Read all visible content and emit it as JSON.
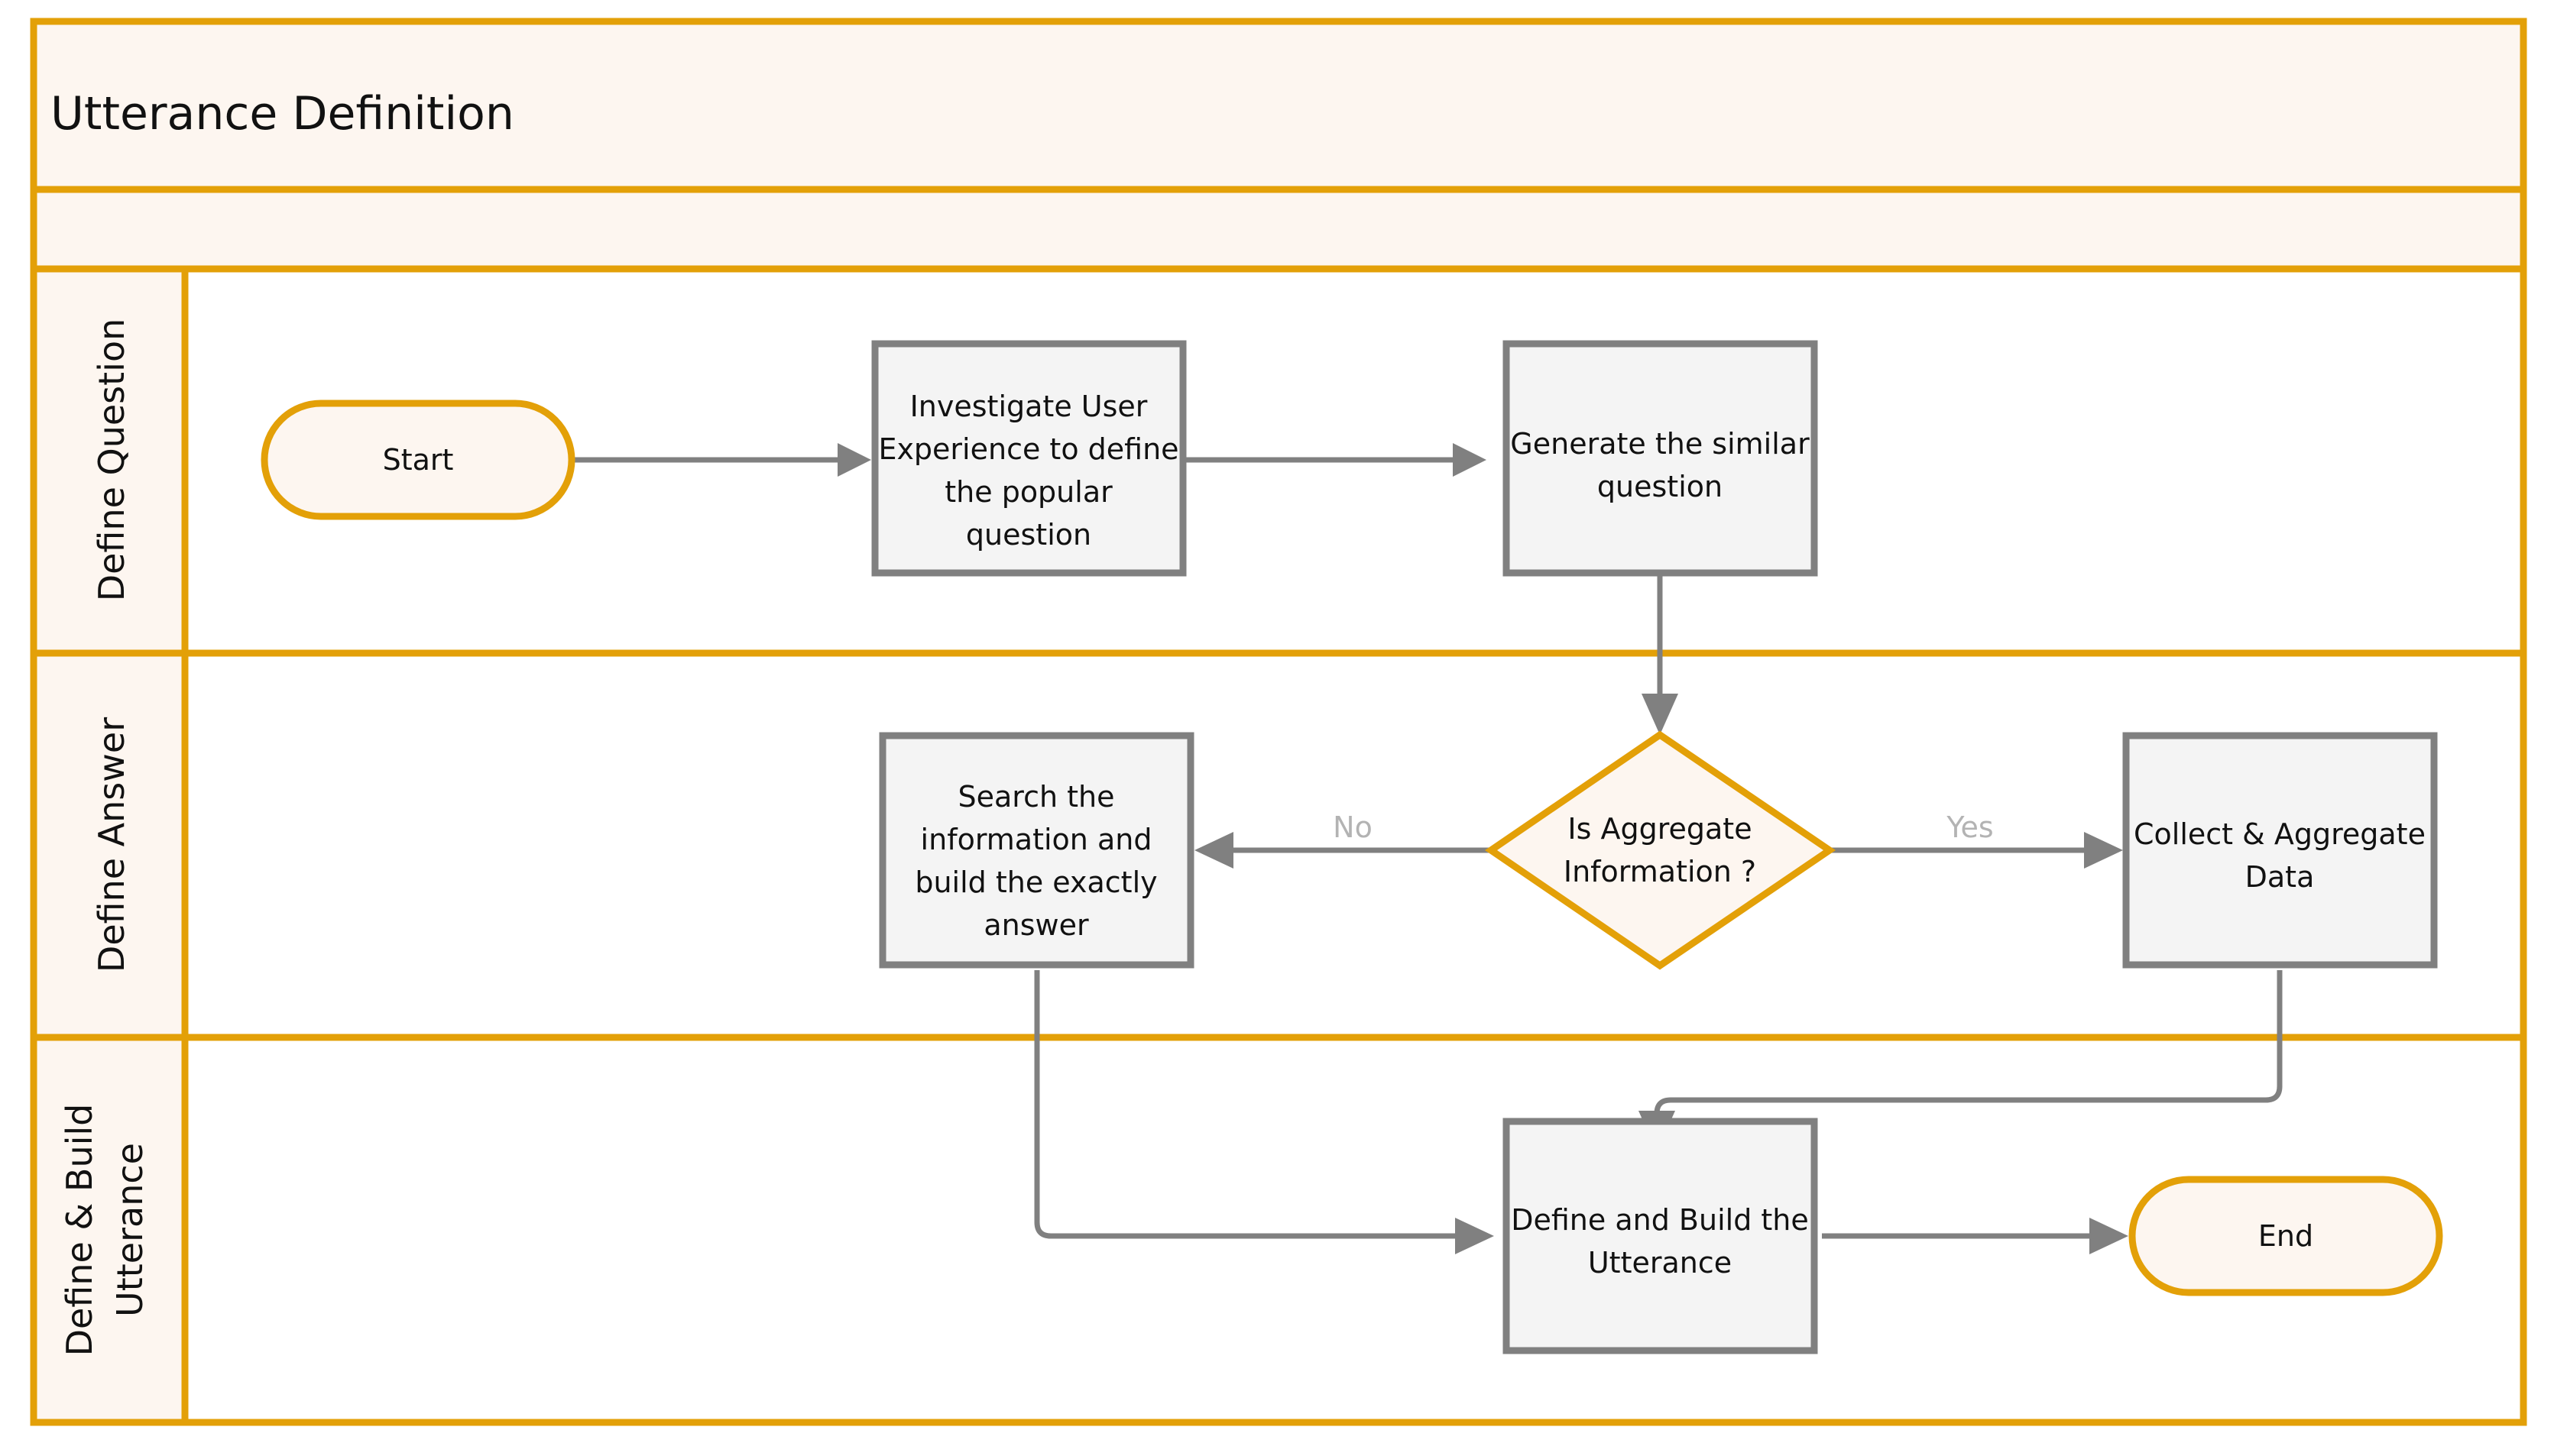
{
  "pool": {
    "title": "Utterance Definition",
    "accent_color": "#e3a008",
    "header_fill": "#fdf6f0",
    "lane_label_fill": "#fdf6f0",
    "node_fill": "#f4f4f4",
    "node_stroke": "#808080",
    "connector_color": "#808080",
    "edge_label_color": "#b3b3b3"
  },
  "lanes": [
    {
      "id": "lane-define-question",
      "label": "Define Question"
    },
    {
      "id": "lane-define-answer",
      "label": "Define Answer"
    },
    {
      "id": "lane-define-build-utterance",
      "label_line1": "Define & Build",
      "label_line2": "Utterance"
    }
  ],
  "nodes": {
    "start": {
      "label": "Start",
      "shape": "terminator"
    },
    "investigate": {
      "shape": "process",
      "lines": [
        "Investigate User",
        "Experience to define",
        "the popular",
        "question"
      ]
    },
    "generate_similar": {
      "shape": "process",
      "lines": [
        "Generate the similar",
        "question"
      ]
    },
    "is_aggregate": {
      "shape": "decision",
      "lines": [
        "Is Aggregate",
        "Information ?"
      ]
    },
    "search_info": {
      "shape": "process",
      "lines": [
        "Search the",
        "information and",
        "build the exactly",
        "answer"
      ]
    },
    "collect_aggregate": {
      "shape": "process",
      "lines": [
        "Collect & Aggregate",
        "Data"
      ]
    },
    "define_build": {
      "shape": "process",
      "lines": [
        "Define and Build the",
        "Utterance"
      ]
    },
    "end": {
      "label": "End",
      "shape": "terminator"
    }
  },
  "edge_labels": {
    "no": "No",
    "yes": "Yes"
  },
  "flow": [
    {
      "from": "start",
      "to": "investigate",
      "label": ""
    },
    {
      "from": "investigate",
      "to": "generate_similar",
      "label": ""
    },
    {
      "from": "generate_similar",
      "to": "is_aggregate",
      "label": ""
    },
    {
      "from": "is_aggregate",
      "to": "search_info",
      "label": "No"
    },
    {
      "from": "is_aggregate",
      "to": "collect_aggregate",
      "label": "Yes"
    },
    {
      "from": "search_info",
      "to": "define_build",
      "label": ""
    },
    {
      "from": "collect_aggregate",
      "to": "define_build",
      "label": ""
    },
    {
      "from": "define_build",
      "to": "end",
      "label": ""
    }
  ]
}
